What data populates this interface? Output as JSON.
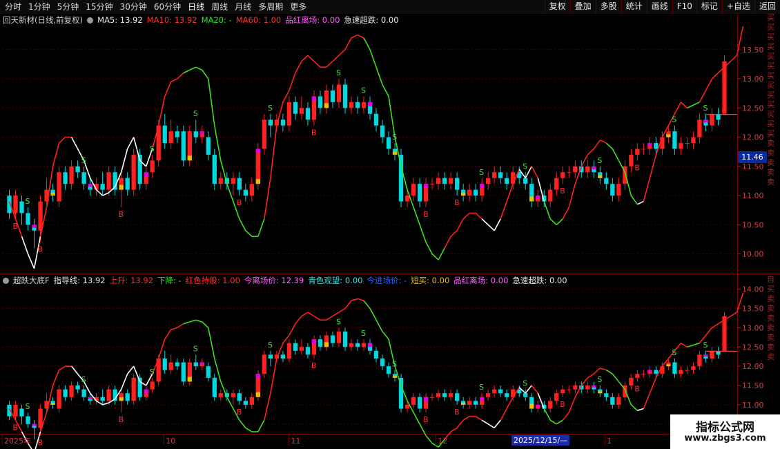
{
  "toolbar": {
    "periods": [
      "分时",
      "1分钟",
      "5分钟",
      "15分钟",
      "30分钟",
      "60分钟",
      "日线",
      "周线",
      "月线",
      "多周期",
      "更多"
    ],
    "active_period": "日线",
    "buttons": [
      "复权",
      "叠加",
      "多股",
      "统计",
      "画线",
      "F10",
      "标记",
      "+自选",
      "返回"
    ]
  },
  "main_chart": {
    "title": "回天新材(日线,前复权)",
    "ma5_label": "MA5: 13.92",
    "ma10_label": "MA10: 13.92",
    "ma20_label": "MA20: -",
    "ma60_label": "MA60: 1.00",
    "pinhong_label": "品红离场: 0.00",
    "jisu_label": "急速超跌: 0.00",
    "y_ticks": [
      "13.50",
      "13.00",
      "12.50",
      "12.00",
      "11.50",
      "11.00",
      "10.50",
      "10.00"
    ],
    "current_price": "11.46",
    "side_text": "买买买买买买买买买买买买买卖卖卖卖卖"
  },
  "sub_chart": {
    "title": "超跌大底F",
    "guide_label": "指导线: 13.92",
    "up_label": "上升: 13.92",
    "down_label": "下降: -",
    "red_hold_label": "红色持股: 1.00",
    "exit_label": "今离场价: 12.39",
    "cyan_label": "青色观望: 0.00",
    "enter_label": "今进场价: -",
    "short_buy_label": "短买: 0.00",
    "pinhong_label": "品红离场: 0.00",
    "jisu_label": "急速超跌: 0.00",
    "y_ticks": [
      "14.00",
      "13.50",
      "13.00",
      "12.50",
      "12.00",
      "11.50",
      "11.00",
      "10.50"
    ],
    "side_text": "自买卖卖卖卖卖卖卖"
  },
  "time_axis": {
    "labels": [
      "2025年",
      "10",
      "11",
      "12",
      "1"
    ],
    "cursor_date": "2025/12/15/—"
  },
  "watermark": {
    "title": "指标公式网",
    "url": "www.zbgs3.com"
  },
  "colors": {
    "up": "#ff2020",
    "down": "#00d8e0",
    "magenta": "#e000e0",
    "yellow": "#e8c000",
    "green_line": "#40e020",
    "grid": "#5a0000"
  },
  "chart_data": {
    "type": "candlestick",
    "ylim_main": [
      9.7,
      13.9
    ],
    "ylim_sub": [
      10.3,
      14.1
    ],
    "candles": [
      {
        "o": 11.0,
        "c": 10.7,
        "h": 11.1,
        "l": 10.6
      },
      {
        "o": 10.7,
        "c": 11.0,
        "h": 11.1,
        "l": 10.6
      },
      {
        "o": 10.9,
        "c": 10.7,
        "h": 11.0,
        "l": 10.5
      },
      {
        "o": 10.7,
        "c": 10.5,
        "h": 10.8,
        "l": 10.4
      },
      {
        "o": 10.5,
        "c": 10.4,
        "h": 10.6,
        "l": 10.1
      },
      {
        "o": 10.4,
        "c": 10.9,
        "h": 11.0,
        "l": 10.2
      },
      {
        "o": 10.9,
        "c": 11.1,
        "h": 11.3,
        "l": 10.8
      },
      {
        "o": 11.1,
        "c": 11.0,
        "h": 11.2,
        "l": 10.9
      },
      {
        "o": 10.9,
        "c": 11.4,
        "h": 11.5,
        "l": 10.8
      },
      {
        "o": 11.4,
        "c": 11.2,
        "h": 11.5,
        "l": 11.1
      },
      {
        "o": 11.2,
        "c": 11.5,
        "h": 11.6,
        "l": 11.1
      },
      {
        "o": 11.5,
        "c": 11.4,
        "h": 11.6,
        "l": 11.3
      },
      {
        "o": 11.4,
        "c": 11.2,
        "h": 11.5,
        "l": 11.1
      },
      {
        "o": 11.2,
        "c": 11.1,
        "h": 11.3,
        "l": 11.0
      },
      {
        "o": 11.1,
        "c": 11.2,
        "h": 11.3,
        "l": 11.0
      },
      {
        "o": 11.2,
        "c": 11.1,
        "h": 11.4,
        "l": 11.0
      },
      {
        "o": 11.1,
        "c": 11.4,
        "h": 11.5,
        "l": 11.0
      },
      {
        "o": 11.4,
        "c": 11.1,
        "h": 11.5,
        "l": 11.0
      },
      {
        "o": 11.1,
        "c": 11.3,
        "h": 11.4,
        "l": 10.8
      },
      {
        "o": 11.3,
        "c": 11.1,
        "h": 11.4,
        "l": 11.0
      },
      {
        "o": 11.1,
        "c": 11.7,
        "h": 11.8,
        "l": 11.0
      },
      {
        "o": 11.7,
        "c": 11.2,
        "h": 11.8,
        "l": 11.1
      },
      {
        "o": 11.2,
        "c": 11.4,
        "h": 11.5,
        "l": 11.1
      },
      {
        "o": 11.4,
        "c": 11.6,
        "h": 11.7,
        "l": 11.3
      },
      {
        "o": 11.6,
        "c": 12.2,
        "h": 12.3,
        "l": 11.5
      },
      {
        "o": 12.2,
        "c": 11.9,
        "h": 12.4,
        "l": 11.8
      },
      {
        "o": 11.9,
        "c": 12.1,
        "h": 12.3,
        "l": 11.8
      },
      {
        "o": 12.1,
        "c": 12.0,
        "h": 12.2,
        "l": 11.9
      },
      {
        "o": 12.1,
        "c": 11.6,
        "h": 12.2,
        "l": 11.5
      },
      {
        "o": 11.6,
        "c": 12.1,
        "h": 12.2,
        "l": 11.5
      },
      {
        "o": 12.1,
        "c": 12.0,
        "h": 12.3,
        "l": 11.9
      },
      {
        "o": 12.0,
        "c": 12.1,
        "h": 12.2,
        "l": 11.9
      },
      {
        "o": 12.0,
        "c": 11.7,
        "h": 12.1,
        "l": 11.6
      },
      {
        "o": 11.7,
        "c": 11.2,
        "h": 11.8,
        "l": 11.1
      },
      {
        "o": 11.2,
        "c": 11.3,
        "h": 11.4,
        "l": 11.1
      },
      {
        "o": 11.3,
        "c": 11.2,
        "h": 11.4,
        "l": 11.1
      },
      {
        "o": 11.2,
        "c": 11.3,
        "h": 11.4,
        "l": 11.0
      },
      {
        "o": 11.3,
        "c": 11.1,
        "h": 11.4,
        "l": 11.0
      },
      {
        "o": 11.1,
        "c": 11.0,
        "h": 11.2,
        "l": 10.9
      },
      {
        "o": 11.0,
        "c": 11.2,
        "h": 11.3,
        "l": 10.9
      },
      {
        "o": 11.2,
        "c": 11.8,
        "h": 11.9,
        "l": 11.1
      },
      {
        "o": 11.8,
        "c": 12.3,
        "h": 12.4,
        "l": 11.7
      },
      {
        "o": 12.3,
        "c": 12.2,
        "h": 12.4,
        "l": 12.0
      },
      {
        "o": 12.2,
        "c": 12.3,
        "h": 12.4,
        "l": 12.1
      },
      {
        "o": 12.3,
        "c": 12.2,
        "h": 12.4,
        "l": 12.1
      },
      {
        "o": 12.2,
        "c": 12.6,
        "h": 12.7,
        "l": 12.1
      },
      {
        "o": 12.6,
        "c": 12.4,
        "h": 12.7,
        "l": 12.3
      },
      {
        "o": 12.4,
        "c": 12.5,
        "h": 12.7,
        "l": 12.3
      },
      {
        "o": 12.5,
        "c": 12.3,
        "h": 12.6,
        "l": 12.2
      },
      {
        "o": 12.3,
        "c": 12.7,
        "h": 12.8,
        "l": 12.2
      },
      {
        "o": 12.7,
        "c": 12.5,
        "h": 12.8,
        "l": 12.4
      },
      {
        "o": 12.5,
        "c": 12.8,
        "h": 12.9,
        "l": 12.4
      },
      {
        "o": 12.8,
        "c": 12.6,
        "h": 12.9,
        "l": 12.5
      },
      {
        "o": 12.6,
        "c": 12.9,
        "h": 13.0,
        "l": 12.5
      },
      {
        "o": 12.9,
        "c": 12.5,
        "h": 13.0,
        "l": 12.4
      },
      {
        "o": 12.5,
        "c": 12.6,
        "h": 12.7,
        "l": 12.4
      },
      {
        "o": 12.6,
        "c": 12.5,
        "h": 12.7,
        "l": 12.4
      },
      {
        "o": 12.5,
        "c": 12.6,
        "h": 12.7,
        "l": 12.4
      },
      {
        "o": 12.6,
        "c": 12.4,
        "h": 12.7,
        "l": 12.3
      },
      {
        "o": 12.4,
        "c": 12.2,
        "h": 12.5,
        "l": 12.1
      },
      {
        "o": 12.2,
        "c": 12.0,
        "h": 12.3,
        "l": 11.9
      },
      {
        "o": 12.0,
        "c": 11.8,
        "h": 12.1,
        "l": 11.7
      },
      {
        "o": 11.8,
        "c": 11.7,
        "h": 11.9,
        "l": 11.6
      },
      {
        "o": 11.7,
        "c": 10.9,
        "h": 11.8,
        "l": 10.8
      },
      {
        "o": 10.9,
        "c": 11.0,
        "h": 11.1,
        "l": 10.8
      },
      {
        "o": 11.0,
        "c": 11.2,
        "h": 11.3,
        "l": 10.9
      },
      {
        "o": 11.2,
        "c": 10.9,
        "h": 11.3,
        "l": 10.8
      },
      {
        "o": 10.9,
        "c": 11.2,
        "h": 11.3,
        "l": 10.8
      },
      {
        "o": 11.2,
        "c": 11.2,
        "h": 11.3,
        "l": 11.1
      },
      {
        "o": 11.2,
        "c": 11.3,
        "h": 11.4,
        "l": 11.1
      },
      {
        "o": 11.3,
        "c": 11.2,
        "h": 11.4,
        "l": 11.1
      },
      {
        "o": 11.2,
        "c": 11.3,
        "h": 11.4,
        "l": 11.1
      },
      {
        "o": 11.3,
        "c": 11.1,
        "h": 11.4,
        "l": 11.0
      },
      {
        "o": 11.1,
        "c": 11.0,
        "h": 11.2,
        "l": 10.9
      },
      {
        "o": 11.0,
        "c": 11.1,
        "h": 11.2,
        "l": 10.9
      },
      {
        "o": 11.1,
        "c": 11.0,
        "h": 11.2,
        "l": 10.9
      },
      {
        "o": 11.0,
        "c": 11.2,
        "h": 11.3,
        "l": 10.9
      },
      {
        "o": 11.2,
        "c": 11.3,
        "h": 11.4,
        "l": 11.1
      },
      {
        "o": 11.3,
        "c": 11.4,
        "h": 11.5,
        "l": 11.2
      },
      {
        "o": 11.4,
        "c": 11.3,
        "h": 11.5,
        "l": 11.2
      },
      {
        "o": 11.3,
        "c": 11.2,
        "h": 11.4,
        "l": 11.1
      },
      {
        "o": 11.2,
        "c": 11.4,
        "h": 11.5,
        "l": 11.1
      },
      {
        "o": 11.4,
        "c": 11.3,
        "h": 11.5,
        "l": 11.2
      },
      {
        "o": 11.3,
        "c": 11.2,
        "h": 11.4,
        "l": 11.1
      },
      {
        "o": 11.2,
        "c": 10.9,
        "h": 11.3,
        "l": 10.8
      },
      {
        "o": 10.9,
        "c": 11.0,
        "h": 11.1,
        "l": 10.8
      },
      {
        "o": 11.0,
        "c": 10.9,
        "h": 11.1,
        "l": 10.8
      },
      {
        "o": 10.9,
        "c": 11.1,
        "h": 11.2,
        "l": 10.8
      },
      {
        "o": 11.1,
        "c": 11.3,
        "h": 11.4,
        "l": 11.0
      },
      {
        "o": 11.3,
        "c": 11.4,
        "h": 11.5,
        "l": 11.2
      },
      {
        "o": 11.4,
        "c": 11.4,
        "h": 11.5,
        "l": 11.3
      },
      {
        "o": 11.4,
        "c": 11.5,
        "h": 11.6,
        "l": 11.3
      },
      {
        "o": 11.5,
        "c": 11.4,
        "h": 11.6,
        "l": 11.3
      },
      {
        "o": 11.4,
        "c": 11.5,
        "h": 11.6,
        "l": 11.3
      },
      {
        "o": 11.5,
        "c": 11.4,
        "h": 11.6,
        "l": 11.3
      },
      {
        "o": 11.4,
        "c": 11.3,
        "h": 11.5,
        "l": 11.2
      },
      {
        "o": 11.3,
        "c": 11.2,
        "h": 11.4,
        "l": 11.1
      },
      {
        "o": 11.2,
        "c": 11.0,
        "h": 11.3,
        "l": 10.9
      },
      {
        "o": 11.0,
        "c": 11.2,
        "h": 11.3,
        "l": 10.9
      },
      {
        "o": 11.2,
        "c": 11.5,
        "h": 11.6,
        "l": 11.1
      },
      {
        "o": 11.5,
        "c": 11.7,
        "h": 11.8,
        "l": 11.4
      },
      {
        "o": 11.7,
        "c": 11.8,
        "h": 11.9,
        "l": 11.6
      },
      {
        "o": 11.8,
        "c": 11.8,
        "h": 11.9,
        "l": 11.7
      },
      {
        "o": 11.8,
        "c": 11.9,
        "h": 12.0,
        "l": 11.7
      },
      {
        "o": 11.9,
        "c": 11.8,
        "h": 12.0,
        "l": 11.7
      },
      {
        "o": 11.8,
        "c": 12.0,
        "h": 12.1,
        "l": 11.7
      },
      {
        "o": 12.0,
        "c": 12.1,
        "h": 12.2,
        "l": 11.9
      },
      {
        "o": 12.1,
        "c": 11.8,
        "h": 12.2,
        "l": 11.7
      },
      {
        "o": 11.8,
        "c": 11.9,
        "h": 12.0,
        "l": 11.7
      },
      {
        "o": 11.9,
        "c": 11.9,
        "h": 12.0,
        "l": 11.8
      },
      {
        "o": 11.9,
        "c": 12.0,
        "h": 12.1,
        "l": 11.8
      },
      {
        "o": 12.0,
        "c": 12.3,
        "h": 12.4,
        "l": 11.9
      },
      {
        "o": 12.3,
        "c": 12.2,
        "h": 12.4,
        "l": 12.1
      },
      {
        "o": 12.2,
        "c": 12.4,
        "h": 12.5,
        "l": 12.1
      },
      {
        "o": 12.4,
        "c": 12.3,
        "h": 12.5,
        "l": 12.2
      },
      {
        "o": 12.4,
        "c": 13.3,
        "h": 13.4,
        "l": 12.4
      }
    ],
    "guide_line": [
      10.9,
      10.6,
      10.3,
      10.0,
      9.75,
      10.3,
      10.8,
      11.5,
      11.9,
      12.0,
      12.0,
      11.8,
      11.6,
      11.3,
      11.1,
      11.0,
      11.05,
      11.15,
      11.4,
      11.8,
      12.0,
      11.6,
      11.5,
      11.8,
      12.2,
      12.7,
      12.95,
      13.0,
      13.1,
      13.15,
      13.2,
      13.15,
      13.0,
      12.2,
      11.6,
      11.2,
      10.9,
      10.6,
      10.4,
      10.3,
      10.3,
      10.6,
      11.3,
      12.2,
      12.6,
      12.8,
      13.1,
      13.3,
      13.4,
      13.3,
      13.2,
      13.2,
      13.3,
      13.4,
      13.5,
      13.7,
      13.75,
      13.7,
      13.5,
      13.2,
      12.9,
      12.7,
      12.0,
      11.5,
      11.1,
      10.8,
      10.5,
      10.2,
      10.0,
      9.9,
      10.1,
      10.3,
      10.4,
      10.6,
      10.7,
      10.7,
      10.6,
      10.5,
      10.4,
      10.6,
      10.9,
      11.2,
      11.45,
      11.3,
      11.5,
      11.3,
      10.9,
      10.6,
      10.5,
      10.6,
      10.8,
      11.2,
      11.5,
      11.7,
      11.8,
      11.95,
      11.9,
      11.8,
      11.6,
      11.4,
      11.0,
      10.85,
      10.9,
      11.3,
      11.7,
      12.0,
      12.2,
      12.4,
      12.6,
      12.5,
      12.55,
      12.6,
      12.8,
      13.0,
      13.1,
      13.2,
      13.3,
      13.4,
      13.9
    ],
    "guide_color": [
      "r",
      "r",
      "w",
      "w",
      "w",
      "r",
      "r",
      "r",
      "r",
      "r",
      "w",
      "w",
      "w",
      "w",
      "w",
      "w",
      "w",
      "w",
      "w",
      "w",
      "w",
      "w",
      "w",
      "r",
      "r",
      "r",
      "r",
      "r",
      "g",
      "g",
      "g",
      "g",
      "g",
      "g",
      "g",
      "g",
      "g",
      "g",
      "g",
      "g",
      "g",
      "r",
      "r",
      "r",
      "r",
      "r",
      "r",
      "r",
      "r",
      "r",
      "r",
      "r",
      "r",
      "r",
      "r",
      "r",
      "r",
      "g",
      "g",
      "g",
      "g",
      "g",
      "g",
      "g",
      "g",
      "g",
      "g",
      "g",
      "g",
      "g",
      "r",
      "r",
      "r",
      "r",
      "r",
      "r",
      "w",
      "w",
      "w",
      "r",
      "r",
      "r",
      "w",
      "w",
      "r",
      "w",
      "g",
      "g",
      "g",
      "r",
      "r",
      "r",
      "r",
      "r",
      "r",
      "r",
      "g",
      "g",
      "g",
      "g",
      "g",
      "w",
      "r",
      "r",
      "r",
      "r",
      "r",
      "r",
      "r",
      "g",
      "g",
      "r",
      "r",
      "r",
      "r",
      "r",
      "r",
      "r",
      "r",
      "r"
    ],
    "buy_signals": [
      1,
      5,
      18,
      37,
      49,
      67,
      72,
      89,
      101
    ],
    "sell_signals": [
      3,
      12,
      23,
      30,
      42,
      53,
      57,
      62,
      76,
      83,
      95,
      107,
      112
    ],
    "exit_price_line": 12.39
  }
}
